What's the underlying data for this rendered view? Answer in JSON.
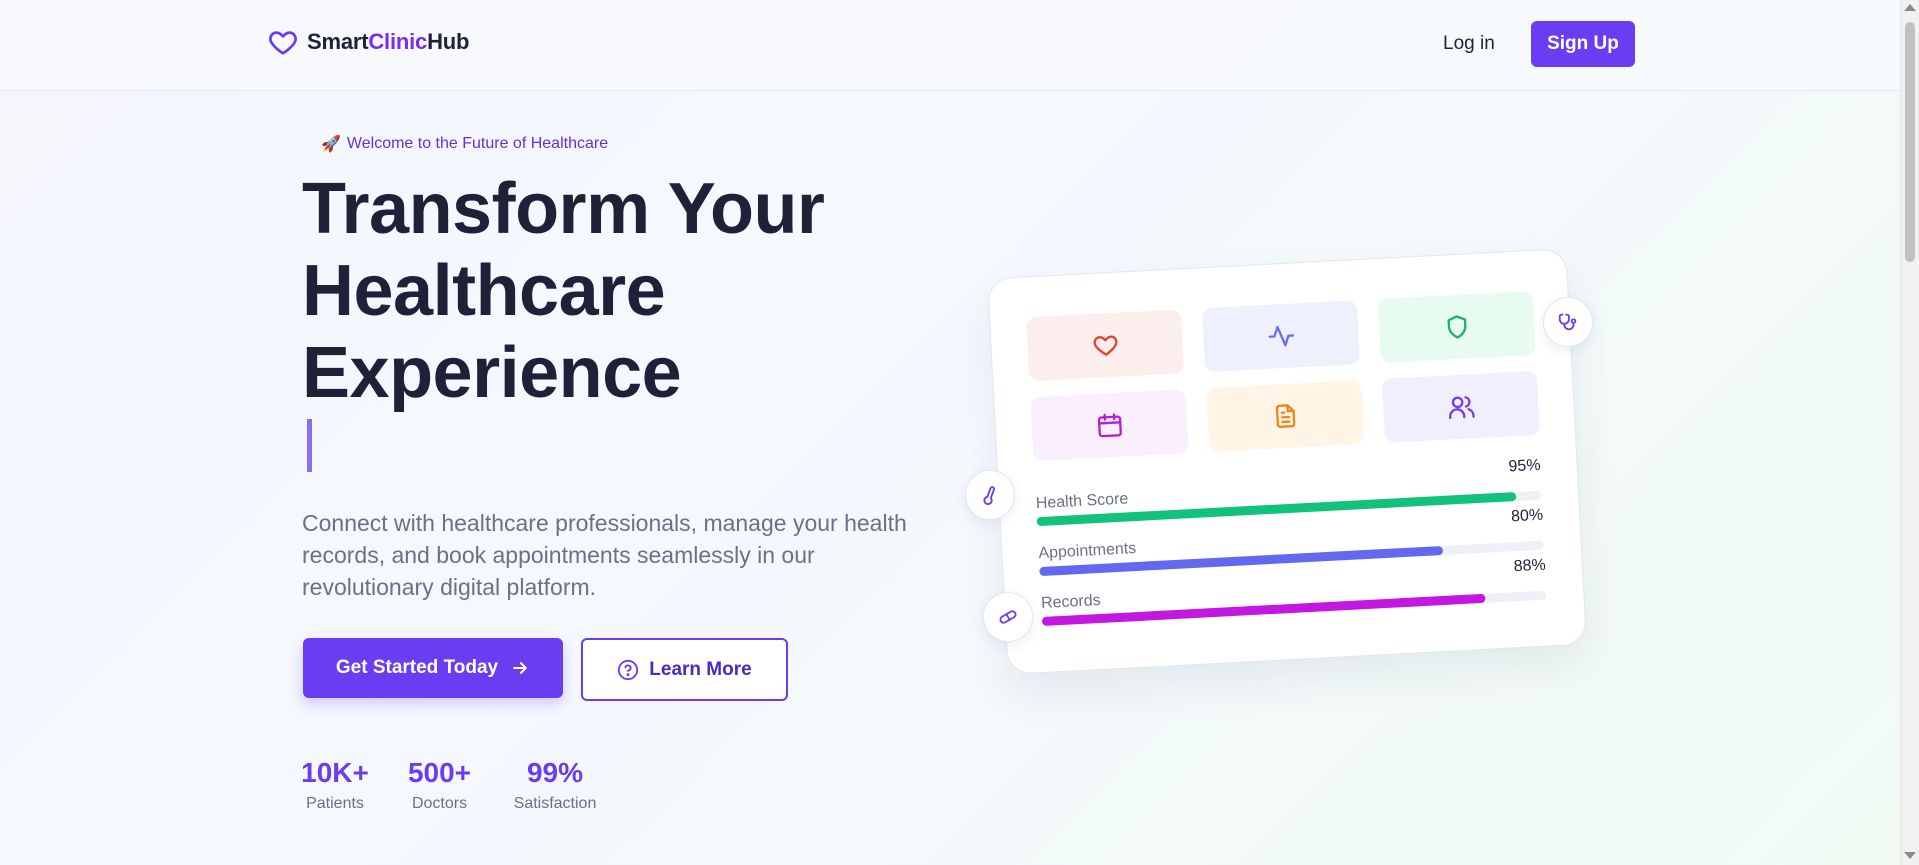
{
  "brand": {
    "prefix": "Smart",
    "accent": "Clinic",
    "suffix": "Hub"
  },
  "nav": {
    "login": "Log in",
    "signup": "Sign Up"
  },
  "hero": {
    "badge": "Welcome to the Future of Healthcare",
    "title_line1": "Transform Your",
    "title_line2": "Healthcare",
    "title_line3": "Experience",
    "description": "Connect with healthcare professionals, manage your health records, and book appointments seamlessly in our revolutionary digital platform.",
    "cta_primary": "Get Started Today",
    "cta_secondary": "Learn More"
  },
  "stats": [
    {
      "value": "10K+",
      "label": "Patients"
    },
    {
      "value": "500+",
      "label": "Doctors"
    },
    {
      "value": "99%",
      "label": "Satisfaction"
    }
  ],
  "dashboard": {
    "tiles": [
      {
        "icon": "heart-icon",
        "bg": "#fdeeee",
        "color": "#e8402f"
      },
      {
        "icon": "activity-icon",
        "bg": "#eef1fd",
        "color": "#6a6ff0"
      },
      {
        "icon": "shield-icon",
        "bg": "#e8fbf1",
        "color": "#18b476"
      },
      {
        "icon": "calendar-icon",
        "bg": "#faeffd",
        "color": "#b51fd4"
      },
      {
        "icon": "document-icon",
        "bg": "#fff4e6",
        "color": "#f08418"
      },
      {
        "icon": "users-icon",
        "bg": "#efeffd",
        "color": "#7a3ae8"
      }
    ],
    "metrics": [
      {
        "label": "Health Score",
        "percent_text": "95%",
        "value": 0.95,
        "color": "#10c27c"
      },
      {
        "label": "Appointments",
        "percent_text": "80%",
        "value": 0.8,
        "color": "#6468f0"
      },
      {
        "label": "Records",
        "percent_text": "88%",
        "value": 0.88,
        "color": "#c418e2"
      }
    ]
  },
  "colors": {
    "primary": "#6a3cf2",
    "heading": "#1e2238",
    "muted": "#6a7187"
  }
}
